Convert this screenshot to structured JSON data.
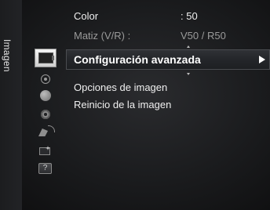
{
  "sidebar": {
    "title": "Imagen"
  },
  "icons": [
    "picture-icon",
    "sound-icon",
    "channel-icon",
    "setup-icon",
    "input-icon",
    "application-icon",
    "support-icon"
  ],
  "menu": {
    "rows": [
      {
        "label": "Color",
        "value": ": 50",
        "dim": false
      },
      {
        "label": "Matiz (V/R) :",
        "value": "V50 / R50",
        "dim": true
      }
    ],
    "selected": {
      "label": "Configuración avanzada"
    },
    "items": [
      {
        "label": "Opciones de imagen"
      },
      {
        "label": "Reinicio de la imagen"
      }
    ]
  },
  "colors": {
    "background": "#1a1b1d",
    "text": "#f0f0f0",
    "dim_text": "#9a9a9a",
    "highlight": "#2a2c30"
  }
}
